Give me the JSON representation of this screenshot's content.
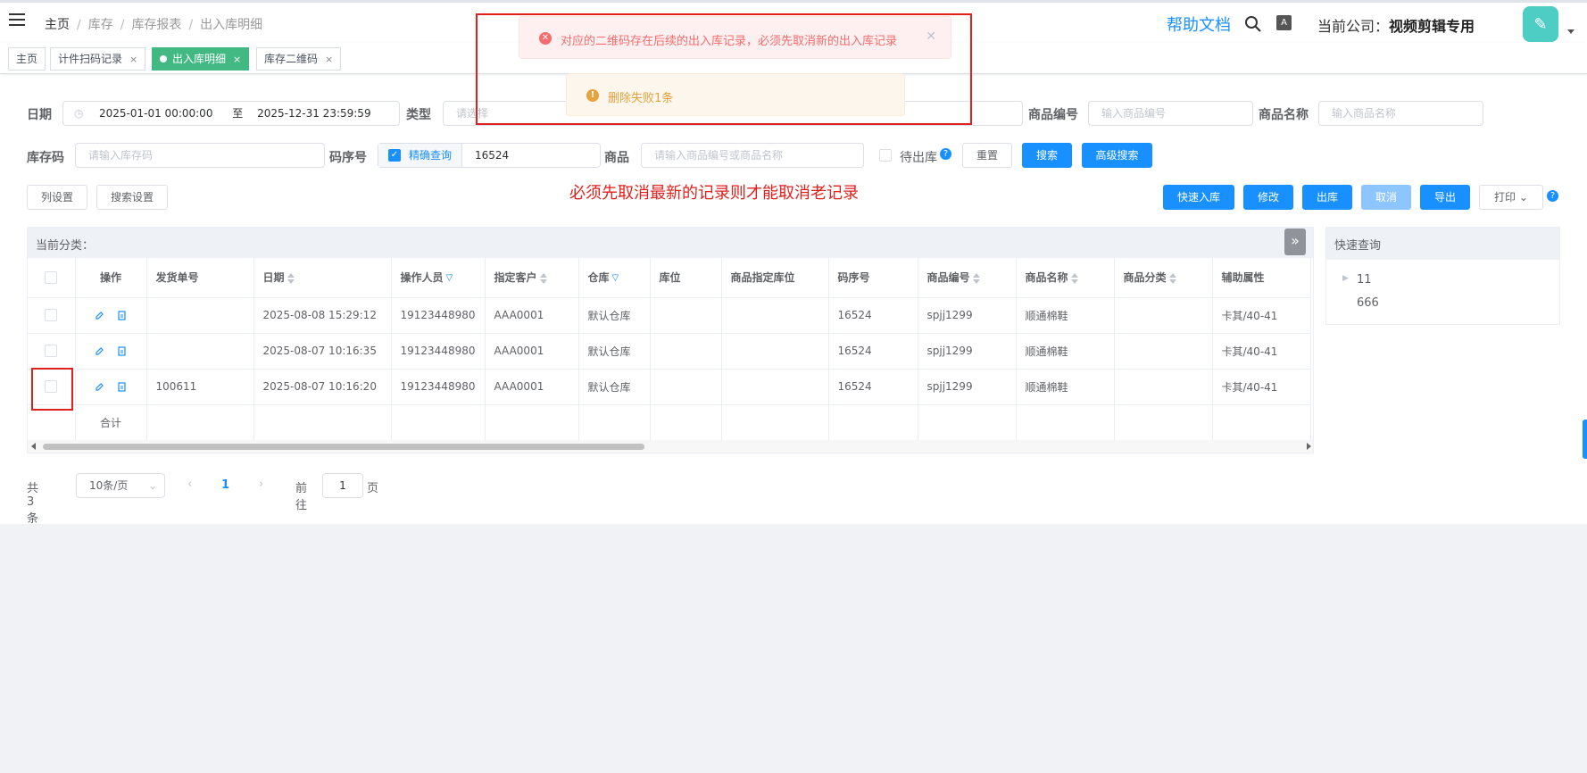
{
  "header": {
    "breadcrumb": [
      "主页",
      "库存",
      "库存报表",
      "出入库明细"
    ],
    "help_label": "帮助文档",
    "company_label": "当前公司：",
    "company_name": "视频剪辑专用"
  },
  "tags": [
    {
      "label": "主页"
    },
    {
      "label": "计件扫码记录"
    },
    {
      "label": "出入库明细"
    },
    {
      "label": "库存二维码"
    }
  ],
  "filters": {
    "date_label": "日期",
    "date_start": "2025-01-01 00:00:00",
    "date_sep": "至",
    "date_end": "2025-12-31 23:59:59",
    "type_label": "类型",
    "type_placeholder": "请选择",
    "product_code_label": "商品编号",
    "product_code_placeholder": "输入商品编号",
    "product_name_label": "商品名称",
    "product_name_placeholder": "输入商品名称",
    "stock_code_label": "库存码",
    "stock_code_placeholder": "请输入库存码",
    "serial_label": "码序号",
    "exact_label": "精确查询",
    "serial_value": "16524",
    "product_label": "商品",
    "product_placeholder": "请输入商品编号或商品名称",
    "pending_label": "待出库"
  },
  "buttons": {
    "reset": "重置",
    "search": "搜索",
    "advanced": "高级搜索",
    "column_settings": "列设置",
    "search_settings": "搜索设置",
    "quick_in": "快速入库",
    "edit": "修改",
    "outbound": "出库",
    "cancel": "取消",
    "export": "导出",
    "print": "打印"
  },
  "annotation": "必须先取消最新的记录则才能取消老记录",
  "table": {
    "category_label": "当前分类：",
    "columns": [
      "操作",
      "发货单号",
      "日期",
      "操作人员",
      "指定客户",
      "仓库",
      "库位",
      "商品指定库位",
      "码序号",
      "商品编号",
      "商品名称",
      "商品分类",
      "辅助属性"
    ],
    "rows": [
      {
        "ship_no": "",
        "date": "2025-08-08 15:29:12",
        "operator": "19123448980",
        "customer": "AAA0001",
        "warehouse": "默认仓库",
        "location": "",
        "assigned_location": "",
        "serial": "16524",
        "product_code": "spjj1299",
        "product_name": "顺通棉鞋",
        "category": "",
        "attr": "卡其/40-41"
      },
      {
        "ship_no": "",
        "date": "2025-08-07 10:16:35",
        "operator": "19123448980",
        "customer": "AAA0001",
        "warehouse": "默认仓库",
        "location": "",
        "assigned_location": "",
        "serial": "16524",
        "product_code": "spjj1299",
        "product_name": "顺通棉鞋",
        "category": "",
        "attr": "卡其/40-41"
      },
      {
        "ship_no": "100611",
        "date": "2025-08-07 10:16:20",
        "operator": "19123448980",
        "customer": "AAA0001",
        "warehouse": "默认仓库",
        "location": "",
        "assigned_location": "",
        "serial": "16524",
        "product_code": "spjj1299",
        "product_name": "顺通棉鞋",
        "category": "",
        "attr": "卡其/40-41"
      }
    ],
    "total_label": "合计"
  },
  "quick_query": {
    "title": "快速查询",
    "items": [
      "11",
      "666"
    ]
  },
  "pagination": {
    "total": "共 3 条",
    "page_size": "10条/页",
    "current_page": "1",
    "goto_label": "前往",
    "goto_value": "1",
    "page_suffix": "页"
  },
  "messages": {
    "error": "对应的二维码存在后续的出入库记录，必须先取消新的出入库记录",
    "warning": "删除失败1条"
  }
}
